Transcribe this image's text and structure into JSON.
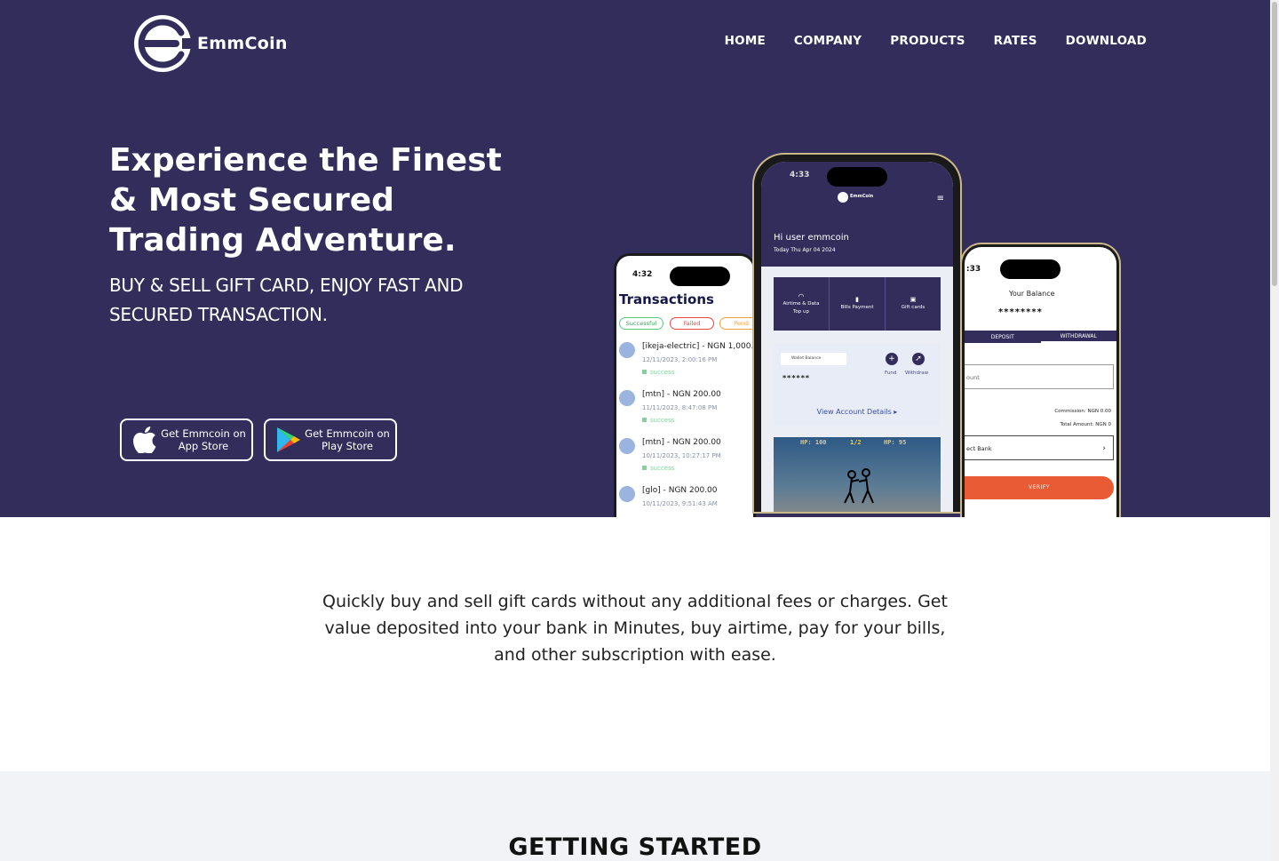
{
  "brand": {
    "name": "EmmCoin"
  },
  "nav": {
    "items": [
      {
        "label": "HOME"
      },
      {
        "label": "COMPANY"
      },
      {
        "label": "PRODUCTS"
      },
      {
        "label": "RATES"
      },
      {
        "label": "DOWNLOAD"
      }
    ]
  },
  "hero": {
    "title": "Experience the Finest & Most Secured Trading Adventure.",
    "subtitle": "BUY & SELL GIFT CARD, ENJOY FAST AND SECURED TRANSACTION.",
    "app_store": "Get Emmcoin on App Store",
    "play_store": "Get Emmcoin on Play Store"
  },
  "phone_left": {
    "time": "4:32",
    "title": "Transactions",
    "filters": [
      "Successful",
      "Failed",
      "Pendi"
    ],
    "transactions": [
      {
        "title": "[ikeja-electric] - NGN 1,000.",
        "date": "12/11/2023, 2:00:16 PM",
        "status": "success"
      },
      {
        "title": "[mtn] - NGN  200.00",
        "date": "11/11/2023, 8:47:08 PM",
        "status": "success"
      },
      {
        "title": "[mtn] - NGN  200.00",
        "date": "10/11/2023, 10:27:17 PM",
        "status": "success"
      },
      {
        "title": "[glo] - NGN  200.00",
        "date": "10/11/2023, 9:51:43 AM",
        "status": ""
      }
    ]
  },
  "phone_center": {
    "time": "4:33",
    "greeting": "Hi user emmcoin",
    "date": "Today Thu Apr 04 2024",
    "services": [
      {
        "label": "Airtime & Data Top up"
      },
      {
        "label": "Bills Payment"
      },
      {
        "label": "Gift cards"
      }
    ],
    "wallet_label": "Wallet Balance",
    "balance": "******",
    "fund": "Fund",
    "withdraw": "Withdraw",
    "view_account": "View Account Details",
    "game_hp_left": "HP: 100",
    "game_round": "1/2",
    "game_hp_right": "HP: 95"
  },
  "phone_right": {
    "time": ":33",
    "balance_label": "Your Balance",
    "balance": "********",
    "tab_deposit": "DEPOSIT",
    "tab_withdrawal": "WITHDRAWAL",
    "amount_placeholder": "ount",
    "commission": "Commission: NGN 0.00",
    "total": "Total Amount: NGN 0",
    "bank": "ect Bank",
    "verify": "VERIFY"
  },
  "intro": {
    "text": "Quickly buy and sell gift cards without any additional fees or charges. Get value deposited into your bank in Minutes, buy airtime, pay for your bills, and other subscription with ease."
  },
  "getting_started": {
    "title": "GETTING STARTED"
  },
  "colors": {
    "primary": "#332d5c",
    "accent": "#e85b34",
    "white": "#ffffff"
  }
}
